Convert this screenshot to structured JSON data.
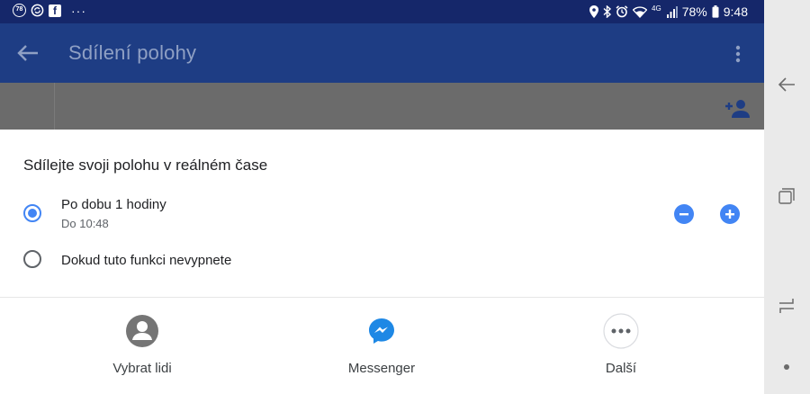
{
  "status_bar": {
    "badge_count": "78",
    "dots": "···",
    "facebook_glyph": "f",
    "network": "4G",
    "battery": "78%",
    "time": "9:48",
    "icons": [
      "notification-badge-icon",
      "sync-icon",
      "facebook-icon",
      "location-icon",
      "bluetooth-icon",
      "alarm-icon",
      "wifi-icon",
      "signal-icon",
      "battery-icon"
    ]
  },
  "app_bar": {
    "title": "Sdílení polohy",
    "icons": [
      "back-arrow-icon",
      "overflow-menu-icon"
    ]
  },
  "background": {
    "icons": [
      "add-person-icon"
    ]
  },
  "sheet": {
    "title": "Sdílejte svoji polohu v reálném čase",
    "options": [
      {
        "label": "Po dobu 1 hodiny",
        "sublabel": "Do 10:48",
        "selected": true
      },
      {
        "label": "Dokud tuto funkci nevypnete",
        "selected": false
      }
    ],
    "icons": [
      "minus-icon",
      "plus-icon"
    ],
    "share_targets": [
      {
        "label": "Vybrat lidi",
        "icon": "person-icon"
      },
      {
        "label": "Messenger",
        "icon": "messenger-icon"
      },
      {
        "label": "Další",
        "icon": "more-icon"
      }
    ]
  },
  "nav_bar": {
    "icons": [
      "nav-back-icon",
      "recents-icon",
      "nav-switch-icon",
      "home-dot-icon"
    ]
  },
  "colors": {
    "status_bar": "#15276a",
    "app_bar": "#1e3d84",
    "title_muted": "#8fa0c4",
    "scrim": "#6b6b6b",
    "accent": "#4285f4",
    "nav_bar": "#eaeaea"
  }
}
